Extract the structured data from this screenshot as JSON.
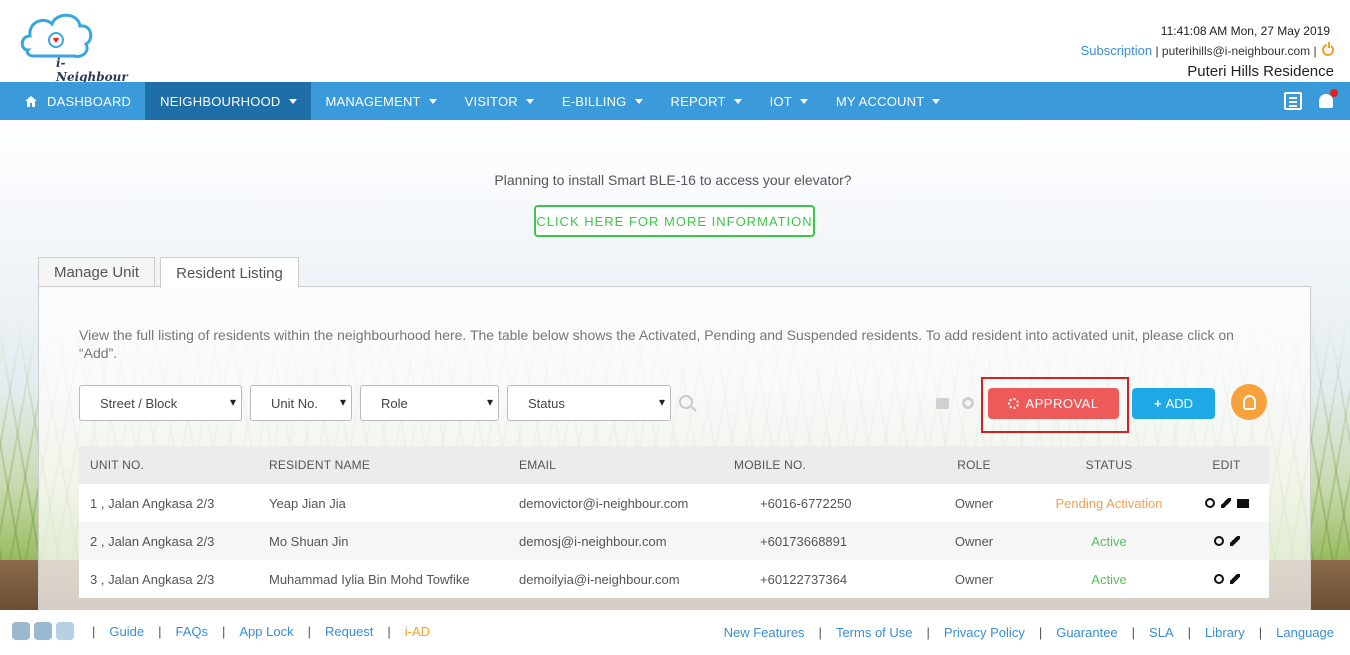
{
  "header": {
    "brand": "i-Neighbour",
    "datetime": "11:41:08 AM  Mon, 27 May 2019",
    "subscription": "Subscription",
    "user_email": "puterihills@i-neighbour.com",
    "residence": "Puteri Hills Residence"
  },
  "nav": {
    "dashboard": "DASHBOARD",
    "neighbourhood": "NEIGHBOURHOOD",
    "management": "MANAGEMENT",
    "visitor": "VISITOR",
    "ebilling": "E-BILLING",
    "report": "REPORT",
    "iot": "IOT",
    "my_account": "MY ACCOUNT"
  },
  "promo": {
    "text": "Planning to install Smart BLE-16 to access your elevator?",
    "button": "CLICK HERE FOR MORE INFORMATION"
  },
  "tabs": {
    "manage_unit": "Manage Unit",
    "resident_listing": "Resident Listing"
  },
  "description": "View the full listing of residents within the neighbourhood here. The table below shows the Activated, Pending and Suspended residents. To add resident into activated unit, please click on “Add”.",
  "filters": {
    "street": "Street / Block",
    "unit": "Unit No.",
    "role": "Role",
    "status": "Status"
  },
  "actions": {
    "approval": "APPROVAL",
    "add": "ADD"
  },
  "colors": {
    "nav": "#3b9ad9",
    "nav_active": "#1e6fa8",
    "approval": "#ee5a5a",
    "add": "#1ea8e6",
    "promo": "#3cc64a"
  },
  "table": {
    "headers": {
      "unit": "UNIT NO.",
      "name": "RESIDENT NAME",
      "email": "EMAIL",
      "mobile": "MOBILE NO.",
      "role": "ROLE",
      "status": "STATUS",
      "edit": "EDIT"
    },
    "rows": [
      {
        "unit": "1 , Jalan Angkasa 2/3",
        "name": "Yeap Jian Jia",
        "email": "demovictor@i-neighbour.com",
        "mobile": "+6016-6772250",
        "role": "Owner",
        "status": "Pending Activation"
      },
      {
        "unit": "2 , Jalan Angkasa 2/3",
        "name": "Mo Shuan Jin",
        "email": "demosj@i-neighbour.com",
        "mobile": "+60173668891",
        "role": "Owner",
        "status": "Active"
      },
      {
        "unit": "3 , Jalan Angkasa 2/3",
        "name": "Muhammad Iylia Bin Mohd Towfike",
        "email": "demoilyia@i-neighbour.com",
        "mobile": "+60122737364",
        "role": "Owner",
        "status": "Active"
      }
    ]
  },
  "footer": {
    "guide": "Guide",
    "faqs": "FAQs",
    "app_lock": "App Lock",
    "request": "Request",
    "iad": "i-AD",
    "new_features": "New Features",
    "terms": "Terms of Use",
    "privacy": "Privacy Policy",
    "guarantee": "Guarantee",
    "sla": "SLA",
    "library": "Library",
    "language": "Language"
  }
}
